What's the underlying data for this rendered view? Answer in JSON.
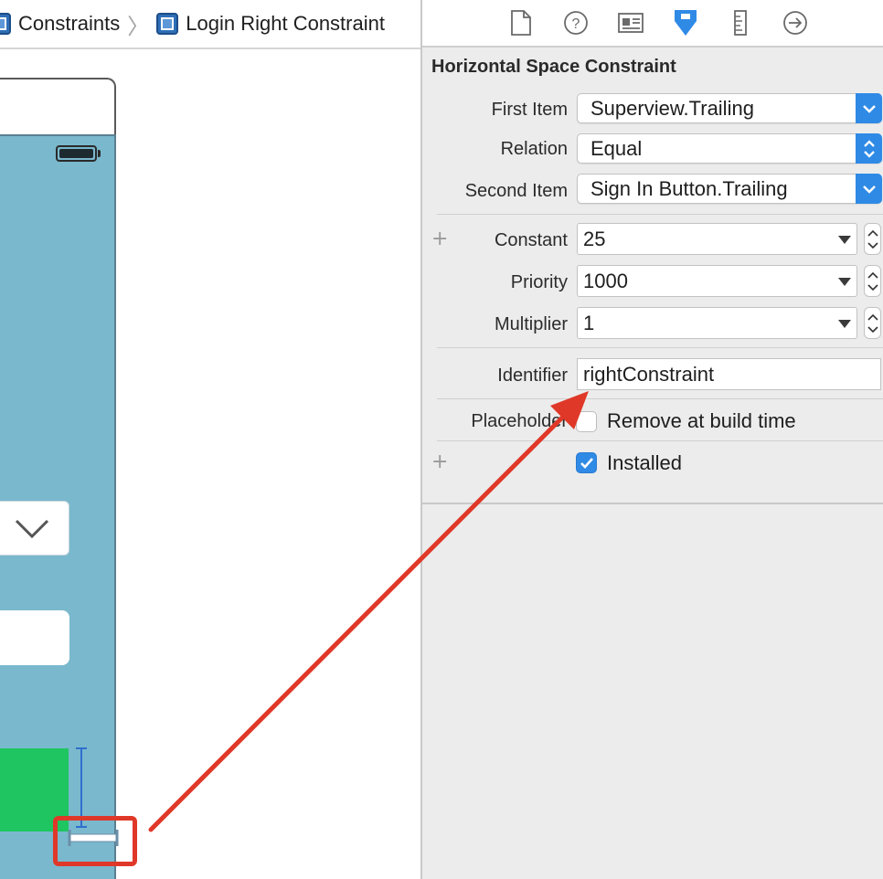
{
  "breadcrumb": {
    "items": [
      {
        "label": "Constraints",
        "icon": "constraints-icon"
      },
      {
        "label": "Login Right Constraint",
        "icon": "constraint-object-icon"
      }
    ],
    "separator": "〉"
  },
  "inspector_toolbar": {
    "icons": [
      "file-inspector-icon",
      "help-icon",
      "identity-inspector-icon",
      "attributes-inspector-icon",
      "size-inspector-icon",
      "connections-inspector-icon"
    ],
    "active": "attributes-inspector-icon",
    "active_color": "#2f8ae6"
  },
  "inspector": {
    "section_title": "Horizontal Space Constraint",
    "first_item": {
      "label": "First Item",
      "value": "Superview.Trailing"
    },
    "relation": {
      "label": "Relation",
      "value": "Equal"
    },
    "second_item": {
      "label": "Second Item",
      "value": "Sign In Button.Trailing"
    },
    "constant": {
      "label": "Constant",
      "value": "25"
    },
    "priority": {
      "label": "Priority",
      "value": "1000"
    },
    "multiplier": {
      "label": "Multiplier",
      "value": "1"
    },
    "identifier": {
      "label": "Identifier",
      "value": "rightConstraint"
    },
    "placeholder": {
      "label": "Placeholder",
      "checkbox_label": "Remove at build time",
      "checked": false
    },
    "installed": {
      "checkbox_label": "Installed",
      "checked": true
    },
    "plus_symbol": "+"
  },
  "colors": {
    "canvas_background": "#7ab8cd",
    "sign_in_button": "#1fc560",
    "annotation_red": "#e03828",
    "accent_blue": "#2f8ae6"
  }
}
